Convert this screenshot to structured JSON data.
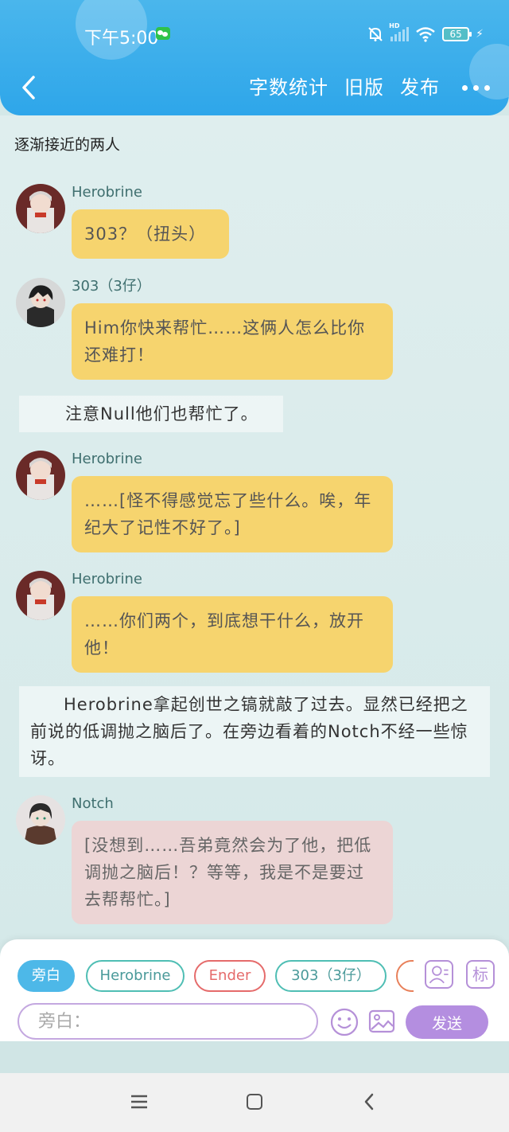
{
  "status_bar": {
    "time": "下午5:00",
    "battery": "65",
    "network": "HD"
  },
  "toolbar": {
    "word_count": "字数统计",
    "old_version": "旧版",
    "publish": "发布"
  },
  "chapter": {
    "title": "逐渐接近的两人"
  },
  "messages": [
    {
      "sender": "Herobrine",
      "text": "303？（扭头）"
    },
    {
      "sender": "303（3仔）",
      "text": "Him你快来帮忙……这俩人怎么比你还难打！"
    },
    {
      "narration": "注意Null他们也帮忙了。"
    },
    {
      "sender": "Herobrine",
      "text": "……[怪不得感觉忘了些什么。唉，年纪大了记性不好了。]"
    },
    {
      "sender": "Herobrine",
      "text": "……你们两个，到底想干什么，放开他！"
    },
    {
      "narration": "Herobrine拿起创世之镐就敲了过去。显然已经把之前说的低调抛之脑后了。在旁边看着的Notch不经一些惊讶。"
    },
    {
      "sender": "Notch",
      "text": "[没想到……吾弟竟然会为了他，把低调抛之脑后！？等等，我是不是要过去帮帮忙。]"
    }
  ],
  "roles": [
    "旁白",
    "Herobrine",
    "Ender",
    "303（3仔）"
  ],
  "input": {
    "placeholder": "旁白："
  },
  "actions": {
    "tag": "标",
    "send": "发送"
  },
  "colors": {
    "header": "#2ea6ea",
    "bubble_yellow": "#f6d46e",
    "bubble_pink": "#ecd5d5",
    "send": "#b48ee0"
  }
}
